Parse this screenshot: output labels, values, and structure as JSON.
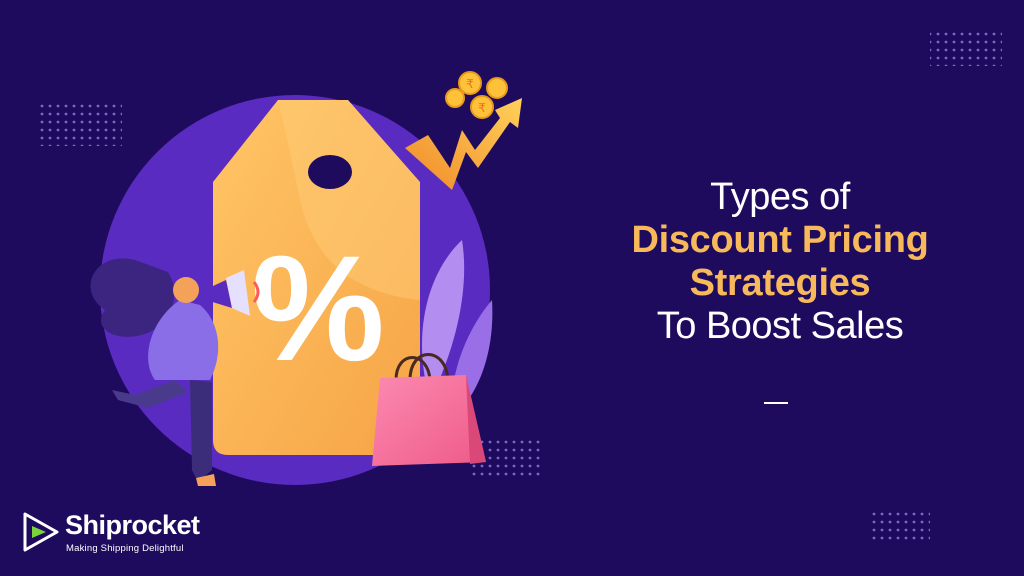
{
  "headline": {
    "line1": "Types of",
    "line2": "Discount Pricing",
    "line3": "Strategies",
    "line4": "To Boost Sales"
  },
  "brand": {
    "name": "Shiprocket",
    "tagline": "Making Shipping Delightful"
  },
  "illustration": {
    "tag_symbol": "%",
    "coin_symbol": "₹"
  },
  "colors": {
    "background": "#1f0b5e",
    "circle": "#5a2bc0",
    "accent": "#f7b95a",
    "tag": "#f8b450",
    "bag": "#f3709b",
    "text": "#ffffff"
  }
}
